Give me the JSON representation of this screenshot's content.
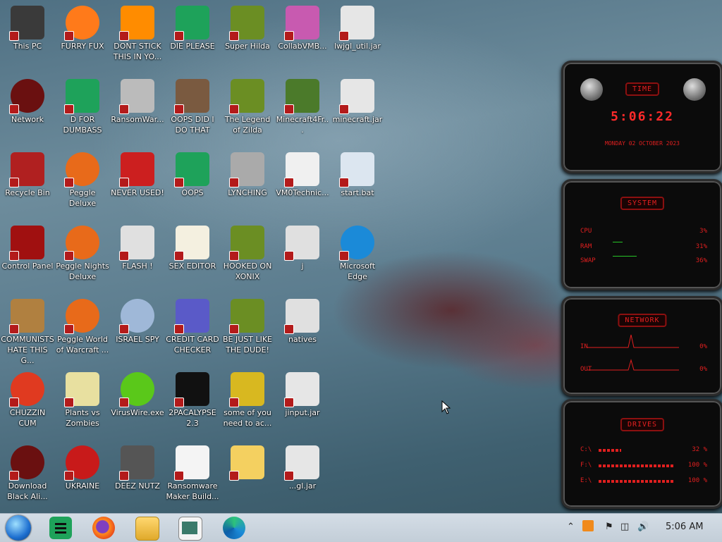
{
  "desktop_icons": [
    {
      "label": "This PC",
      "icon": "computer-icon"
    },
    {
      "label": "FURRY FUX",
      "icon": "firefox-icon"
    },
    {
      "label": "DONT STICK THIS IN YO...",
      "icon": "vlc-cone-icon"
    },
    {
      "label": "DIE PLEASE",
      "icon": "app-icon"
    },
    {
      "label": "Super Hilda",
      "icon": "game-icon"
    },
    {
      "label": "CollabVMB...",
      "icon": "monitor-icon"
    },
    {
      "label": "lwjgl_util.jar",
      "icon": "java-jar-icon"
    },
    {
      "label": "Network",
      "icon": "network-icon"
    },
    {
      "label": "D FOR DUMBASS",
      "icon": "app-icon"
    },
    {
      "label": "RansomWar...",
      "icon": "skull-icon"
    },
    {
      "label": "OOPS DID I DO THAT",
      "icon": "portrait-icon"
    },
    {
      "label": "The Legend of Zilda",
      "icon": "game-icon"
    },
    {
      "label": "Minecraft4Fr...",
      "icon": "grass-block-icon"
    },
    {
      "label": "minecraft.jar",
      "icon": "java-jar-icon"
    },
    {
      "label": "Recycle Bin",
      "icon": "recycle-bin-icon"
    },
    {
      "label": "Peggle Deluxe",
      "icon": "peggle-icon"
    },
    {
      "label": "NEVER USED!",
      "icon": "devcpp-icon"
    },
    {
      "label": "OOPS",
      "icon": "app-icon"
    },
    {
      "label": "LYNCHING",
      "icon": "rope-icon"
    },
    {
      "label": "VM0Technic...",
      "icon": "doctor-icon"
    },
    {
      "label": "start.bat",
      "icon": "batch-file-icon"
    },
    {
      "label": "Control Panel",
      "icon": "control-panel-icon"
    },
    {
      "label": "Peggle Nights Deluxe",
      "icon": "peggle-icon"
    },
    {
      "label": "FLASH !",
      "icon": "file-icon"
    },
    {
      "label": "SEX EDITOR",
      "icon": "hex-editor-icon"
    },
    {
      "label": "HOOKED ON XONIX",
      "icon": "game-icon"
    },
    {
      "label": "j",
      "icon": "file-icon"
    },
    {
      "label": "Microsoft Edge",
      "icon": "edge-icon"
    },
    {
      "label": "COMMUNISTS HATE THIS G...",
      "icon": "money-bag-icon"
    },
    {
      "label": "Peggle World of Warcraft ...",
      "icon": "peggle-icon"
    },
    {
      "label": "ISRAEL SPY",
      "icon": "network-spy-icon"
    },
    {
      "label": "CREDIT CARD CHECKER",
      "icon": "credit-card-icon"
    },
    {
      "label": "BE JUST LIKE THE DUDE!",
      "icon": "game-icon"
    },
    {
      "label": "natives",
      "icon": "file-icon"
    },
    {
      "label": "CHUZZIN CUM",
      "icon": "chuzzle-icon"
    },
    {
      "label": "Plants vs Zombies",
      "icon": "flower-icon"
    },
    {
      "label": "VirusWire.exe",
      "icon": "lime-icon"
    },
    {
      "label": "2PACALYPSE 2.3",
      "icon": "terminal-icon"
    },
    {
      "label": "some of you need to ac...",
      "icon": "dog-icon"
    },
    {
      "label": "jinput.jar",
      "icon": "java-jar-icon"
    },
    {
      "label": "Download Black Ali...",
      "icon": "network-icon"
    },
    {
      "label": "UKRAINE",
      "icon": "radiation-icon"
    },
    {
      "label": "DEEZ NUTZ",
      "icon": "stack-icon"
    },
    {
      "label": "Ransomware Maker Build...",
      "icon": "window-icon"
    },
    {
      "label": "",
      "icon": "cartoon-character-icon"
    },
    {
      "label": "...gl.jar",
      "icon": "java-jar-icon"
    }
  ],
  "gadgets": {
    "time": {
      "title": "TIME",
      "clock": "5:06:22",
      "date": "MONDAY 02 OCTOBER 2023"
    },
    "system": {
      "title": "SYSTEM",
      "rows": [
        {
          "label": "CPU",
          "value": "3%"
        },
        {
          "label": "RAM",
          "value": "31%"
        },
        {
          "label": "SWAP",
          "value": "36%"
        }
      ]
    },
    "network": {
      "title": "NETWORK",
      "rows": [
        {
          "label": "IN",
          "value": "0%"
        },
        {
          "label": "OUT",
          "value": "0%"
        }
      ]
    },
    "drives": {
      "title": "DRIVES",
      "rows": [
        {
          "label": "C:\\",
          "value": "32 %"
        },
        {
          "label": "F:\\",
          "value": "100 %"
        },
        {
          "label": "E:\\",
          "value": "100 %"
        }
      ]
    }
  },
  "taskbar": {
    "clock": "5:06 AM",
    "pinned": [
      {
        "name": "start-button",
        "icon": "start-orb-icon"
      },
      {
        "name": "app-green",
        "icon": "app-icon"
      },
      {
        "name": "firefox",
        "icon": "firefox-icon"
      },
      {
        "name": "file-explorer",
        "icon": "folder-icon"
      },
      {
        "name": "window-app",
        "icon": "window-icon"
      },
      {
        "name": "edge",
        "icon": "edge-icon"
      }
    ]
  },
  "colors": {
    "gadget_red": "#e01f1f",
    "taskbar_bg": "#c9d3dd"
  }
}
